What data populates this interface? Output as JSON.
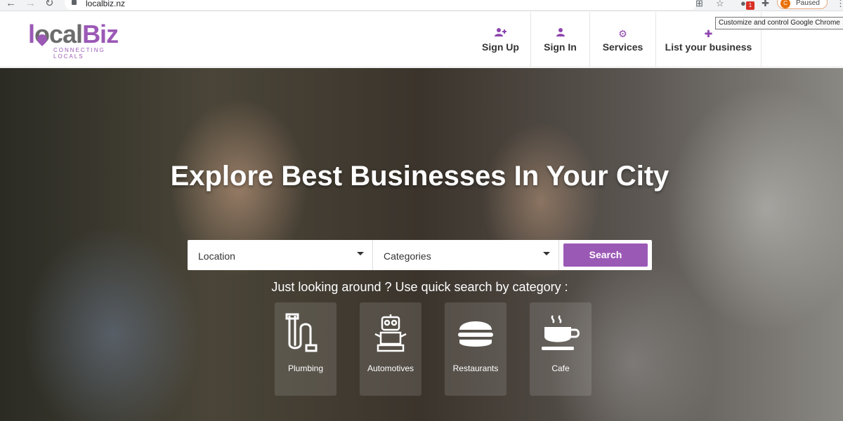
{
  "browser": {
    "url": "localbiz.nz",
    "profile_status": "Paused",
    "profile_initial": "C",
    "extension_badge": "1",
    "tooltip": "Customize and control Google Chrome"
  },
  "logo": {
    "part1": "l",
    "part2": "ocal",
    "part3": "Biz",
    "tagline": "CONNECTING LOCALS"
  },
  "nav": [
    {
      "label": "Sign Up",
      "icon": "user-plus-icon"
    },
    {
      "label": "Sign In",
      "icon": "user-icon"
    },
    {
      "label": "Services",
      "icon": "gear-icon"
    },
    {
      "label": "List your business",
      "icon": "plus-icon"
    }
  ],
  "hero": {
    "title": "Explore Best Businesses In Your City",
    "location_placeholder": "Location",
    "categories_placeholder": "Categories",
    "search_label": "Search",
    "quick_text": "Just looking around ? Use quick search by category :"
  },
  "categories": [
    {
      "label": "Plumbing",
      "icon": "pipe-icon"
    },
    {
      "label": "Automotives",
      "icon": "robot-icon"
    },
    {
      "label": "Restaurants",
      "icon": "burger-icon"
    },
    {
      "label": "Cafe",
      "icon": "coffee-cup-icon"
    }
  ],
  "colors": {
    "brand": "#9b59b6",
    "nav_icon": "#8e44ad"
  }
}
